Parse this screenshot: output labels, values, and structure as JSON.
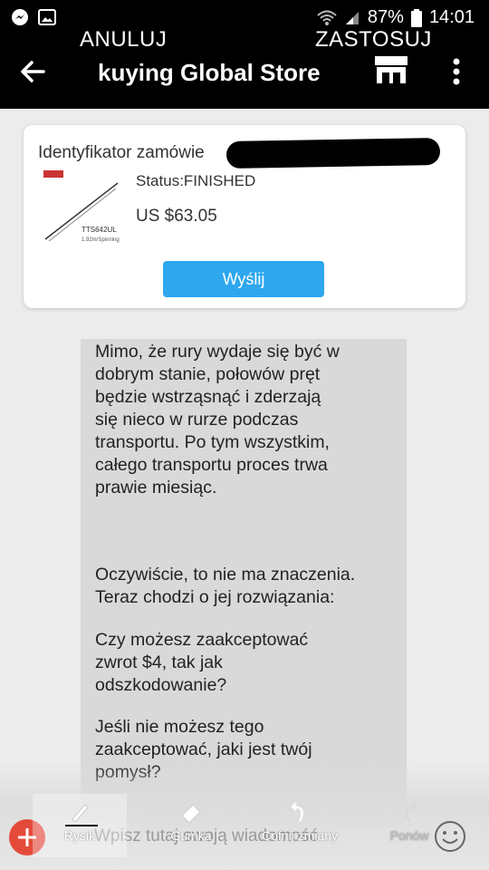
{
  "status_bar": {
    "battery": "87%",
    "time": "14:01"
  },
  "overlay": {
    "cancel_label": "ANULUJ",
    "apply_label": "ZASTOSUJ"
  },
  "app_bar": {
    "title": "kuying Global Store"
  },
  "order_card": {
    "order_id_label": "Identyfikator zamówie",
    "status": "Status:FINISHED",
    "price": "US $63.05",
    "send_label": "Wyślij",
    "product_code": "TTS642UL",
    "product_spec": "1.92m/Spinning"
  },
  "message": {
    "paragraph1": "Mimo, że rury wydaje się być w\ndobrym stanie, połowów pręt\nbędzie wstrząsnąć i zderzają\nsię nieco w rurze podczas\ntransportu. Po tym wszystkim,\ncałego transportu proces trwa\nprawie miesiąc.",
    "paragraph2": "Oczywiście, to nie ma znaczenia.\nTeraz chodzi o jej rozwiązania:",
    "paragraph3": "Czy możesz zaakceptować\nzwrot $4, tak jak\nodszkodowanie?",
    "paragraph4": "Jeśli nie możesz tego\nzaakceptować, jaki jest twój\npomysł?"
  },
  "input": {
    "placeholder": "Wpisz tutaj swoją wiadomość"
  },
  "toolbar": {
    "pen": "Rysik",
    "eraser": "Gumka",
    "undo": "Cofnij zmiany",
    "redo": "Ponów"
  },
  "colors": {
    "accent_blue": "#2ea7ef",
    "plus_red": "#e44a3a"
  }
}
